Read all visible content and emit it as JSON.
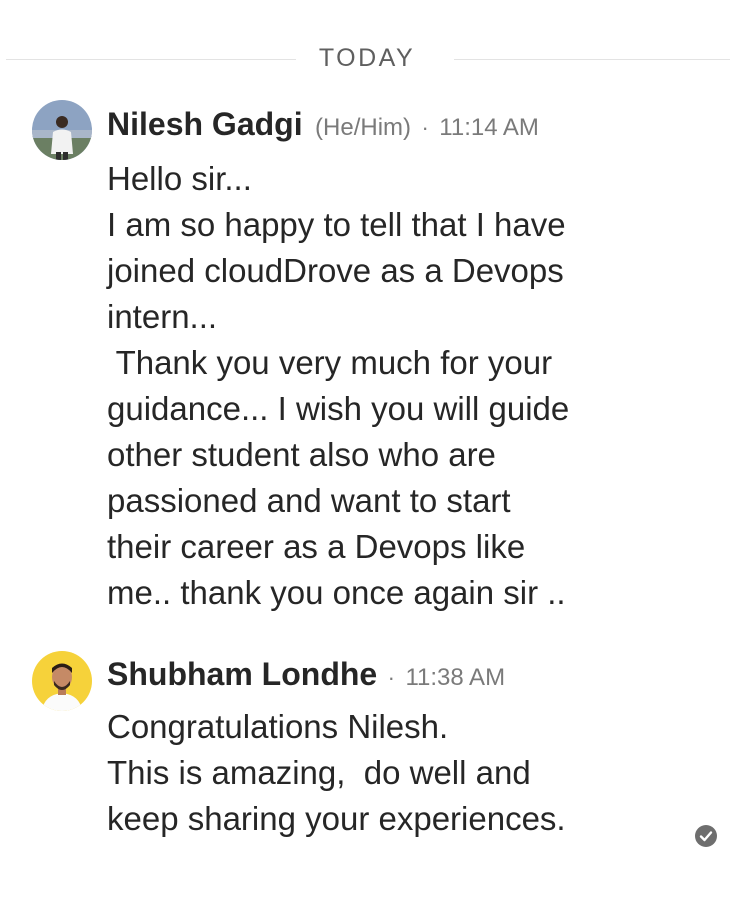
{
  "date_separator": "TODAY",
  "messages": [
    {
      "sender": "Nilesh Gadgi",
      "pronouns": "(He/Him)",
      "separator": "·",
      "time": "11:14 AM",
      "avatar": "person-photo",
      "lines": [
        "Hello sir...",
        "I am so happy to tell that I have",
        "joined cloudDrove as a Devops",
        "intern...",
        " Thank you very much for your",
        "guidance... I wish you will guide",
        "other student also who are",
        "passioned and want to start",
        "their career as a Devops like",
        "me.. thank you once again sir .."
      ]
    },
    {
      "sender": "Shubham Londhe",
      "separator": "·",
      "time": "11:38 AM",
      "avatar": "person-photo",
      "lines": [
        "Congratulations Nilesh.",
        "This is amazing,  do well and",
        "keep sharing your experiences."
      ]
    }
  ],
  "read_receipt_icon": "check-circle-icon"
}
